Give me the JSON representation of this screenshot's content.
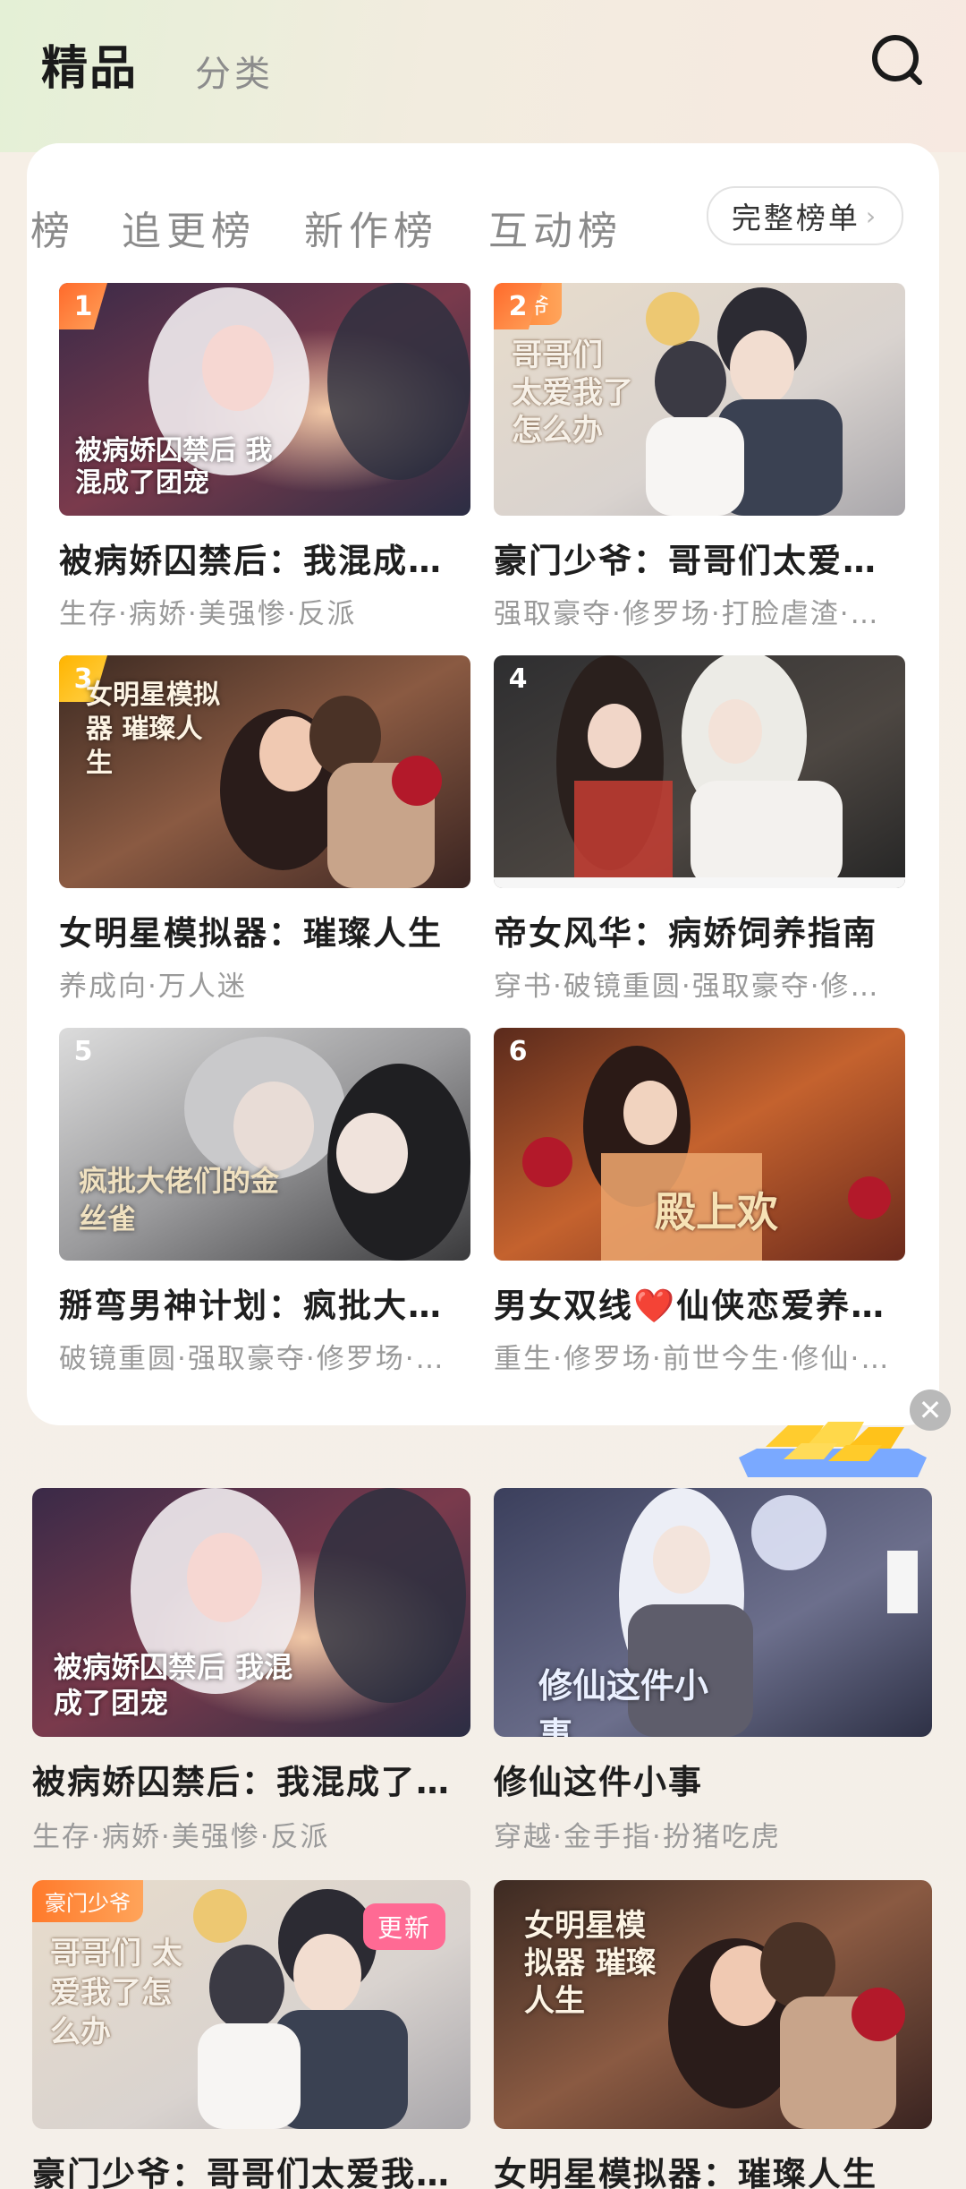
{
  "header": {
    "tab_primary": "精品",
    "tab_secondary": "分类",
    "search_icon": "search-icon"
  },
  "ranking": {
    "tabs": [
      "榜",
      "追更榜",
      "新作榜",
      "互动榜"
    ],
    "full_list_label": "完整榜单",
    "items": [
      {
        "rank": "1",
        "title": "被病娇囚禁后：我混成…",
        "tags": "生存·病娇·美强惨·反派",
        "cover_text": "被病娇囚禁后 我混成了团宠"
      },
      {
        "rank": "2",
        "title": "豪门少爷：哥哥们太爱…",
        "tags": "强取豪夺·修罗场·打脸虐渣·…",
        "cover_text": "哥哥们 太爱我了怎么办",
        "corner": "少爷"
      },
      {
        "rank": "3",
        "title": "女明星模拟器：璀璨人生",
        "tags": "养成向·万人迷",
        "cover_text": "女明星模拟器 璀璨人生"
      },
      {
        "rank": "4",
        "title": "帝女风华：病娇饲养指南",
        "tags": "穿书·破镜重圆·强取豪夺·修…",
        "cover_text": ""
      },
      {
        "rank": "5",
        "title": "掰弯男神计划：疯批大…",
        "tags": "破镜重圆·强取豪夺·修罗场·…",
        "cover_text": "疯批大佬们的金丝雀"
      },
      {
        "rank": "6",
        "title": "男女双线❤️仙侠恋爱养…",
        "tags": "重生·修罗场·前世今生·修仙·…",
        "cover_text": "殿上欢"
      }
    ]
  },
  "promo": {
    "close_icon": "close-icon",
    "close_glyph": "✕",
    "gold_icon": "gold-bars-icon"
  },
  "feed": [
    {
      "title": "被病娇囚禁后：我混成了…",
      "tags": "生存·病娇·美强惨·反派",
      "cover_text": "被病娇囚禁后 我混成了团宠"
    },
    {
      "title": "修仙这件小事",
      "tags": "穿越·金手指·扮猪吃虎",
      "cover_text": "修仙这件小事"
    },
    {
      "title": "豪门少爷：哥哥们太爱我…",
      "tags": "",
      "cover_text": "哥哥们 太爱我了怎么办",
      "corner": "豪门少爷",
      "badge": "更新"
    },
    {
      "title": "女明星模拟器：璀璨人生",
      "tags": "",
      "cover_text": "女明星模拟器 璀璨人生"
    }
  ]
}
